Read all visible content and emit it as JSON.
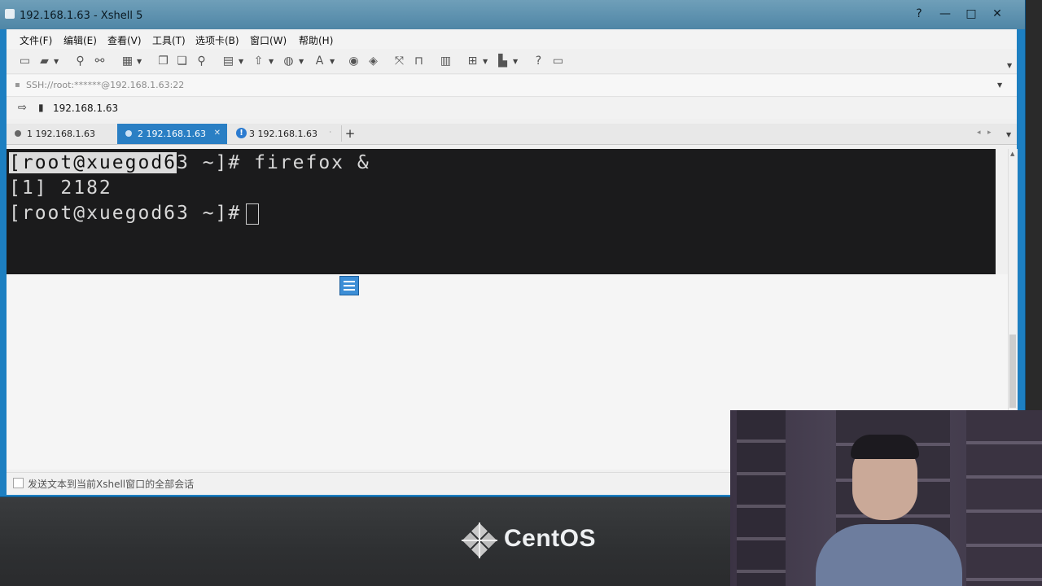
{
  "window": {
    "title": "192.168.1.63 - Xshell 5",
    "controls": [
      "?",
      "—",
      "□",
      "✕"
    ]
  },
  "menu": [
    {
      "label": "文件(F)"
    },
    {
      "label": "编辑(E)"
    },
    {
      "label": "查看(V)"
    },
    {
      "label": "工具(T)"
    },
    {
      "label": "选项卡(B)"
    },
    {
      "label": "窗口(W)"
    },
    {
      "label": "帮助(H)"
    }
  ],
  "address": {
    "text": "SSH://root:******@192.168.1.63:22"
  },
  "session": {
    "label": "192.168.1.63"
  },
  "tabs": [
    {
      "label": "1 192.168.1.63",
      "active": false
    },
    {
      "label": "2 192.168.1.63",
      "active": true
    },
    {
      "label": "3 192.168.1.63",
      "active": false
    }
  ],
  "terminal": {
    "line1_selected": "[root@xuegod6",
    "line1_rest": "3 ~]# firefox &",
    "line2": "[1] 2182",
    "line3": "[root@xuegod63 ~]#"
  },
  "compose": {
    "label": "发送文本到当前Xshell窗口的全部会话"
  },
  "desktop": {
    "brand": "CentOS"
  },
  "colors": {
    "titlebar": "#5b8fae",
    "active_tab": "#2a7fc4",
    "terminal_bg": "#1b1b1c",
    "terminal_fg": "#d8d8d8"
  }
}
